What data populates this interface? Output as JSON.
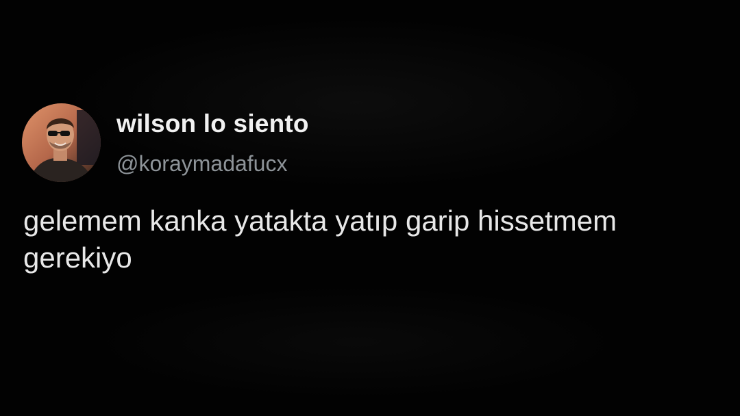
{
  "tweet": {
    "author": {
      "display_name": "wilson lo siento",
      "handle": "@koraymadafucx",
      "avatar_icon": "profile-photo-man-sunglasses"
    },
    "text": "gelemem kanka yatakta yatıp garip hissetmem gerekiyo"
  },
  "colors": {
    "background": "#000000",
    "name": "#f1f1f1",
    "handle": "#8e9499",
    "text": "#e8e8e8"
  }
}
